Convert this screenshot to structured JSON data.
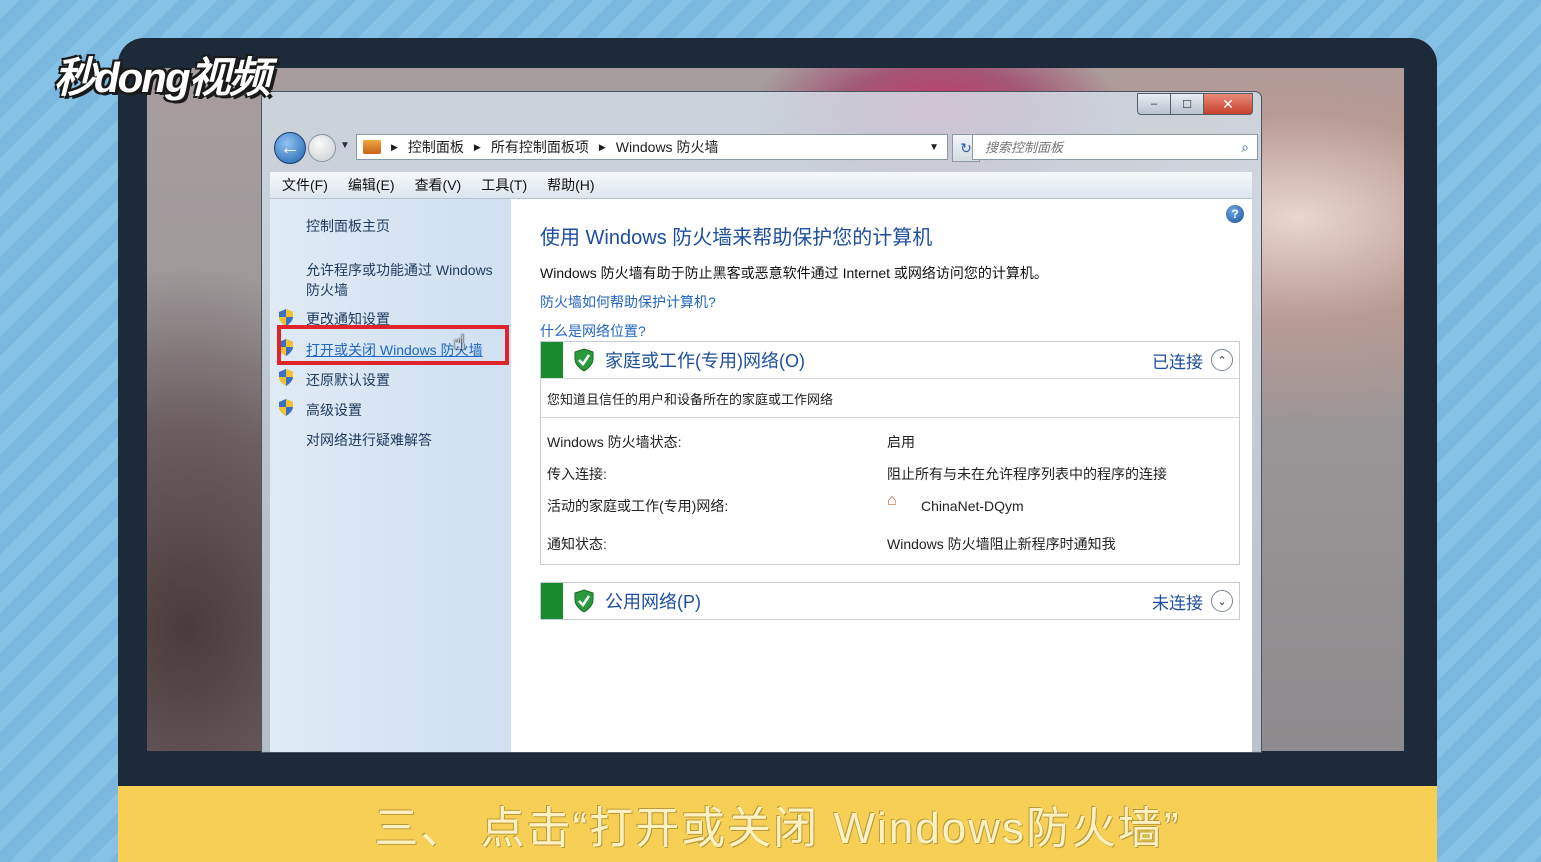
{
  "watermark": "秒dong视频",
  "caption": "三、 点击“打开或关闭 Windows防火墙”",
  "window": {
    "buttons": {
      "minimize": "–",
      "maximize": "☐",
      "close": "✕"
    },
    "nav": {
      "back_symbol": "←",
      "breadcrumb": [
        "控制面板",
        "所有控制面板项",
        "Windows 防火墙"
      ],
      "search_placeholder": "搜索控制面板",
      "search_icon": "⌕",
      "refresh_symbol": "↻"
    },
    "menu": [
      "文件(F)",
      "编辑(E)",
      "查看(V)",
      "工具(T)",
      "帮助(H)"
    ],
    "sidebar": {
      "home": "控制面板主页",
      "allow_programs": "允许程序或功能通过 Windows 防火墙",
      "items": [
        {
          "label": "更改通知设置",
          "icon": "uac-shield-icon"
        },
        {
          "label": "打开或关闭 Windows 防火墙",
          "icon": "uac-shield-icon",
          "active": true
        },
        {
          "label": "还原默认设置",
          "icon": "uac-shield-icon"
        },
        {
          "label": "高级设置",
          "icon": "uac-shield-icon"
        }
      ],
      "troubleshoot": "对网络进行疑难解答"
    },
    "main": {
      "help_symbol": "?",
      "title": "使用 Windows 防火墙来帮助保护您的计算机",
      "description": "Windows 防火墙有助于防止黑客或恶意软件通过 Internet 或网络访问您的计算机。",
      "link1": "防火墙如何帮助保护计算机?",
      "link2": "什么是网络位置?",
      "home_network": {
        "name": "家庭或工作(专用)网络(O)",
        "status": "已连接",
        "expand_symbol": "⌃",
        "subtitle": "您知道且信任的用户和设备所在的家庭或工作网络",
        "rows": [
          {
            "key": "Windows 防火墙状态:",
            "value": "启用"
          },
          {
            "key": "传入连接:",
            "value": "阻止所有与未在允许程序列表中的程序的连接"
          },
          {
            "key": "活动的家庭或工作(专用)网络:",
            "value": "ChinaNet-DQym"
          },
          {
            "key": "通知状态:",
            "value": "Windows 防火墙阻止新程序时通知我"
          }
        ]
      },
      "public_network": {
        "name": "公用网络(P)",
        "status": "未连接",
        "expand_symbol": "⌄"
      }
    }
  },
  "colors": {
    "accent_blue": "#1e4f9c",
    "link_blue": "#2166c1",
    "status_green": "#1a8a2e",
    "highlight_red": "#e0242e",
    "caption_yellow": "#f7cf55"
  }
}
